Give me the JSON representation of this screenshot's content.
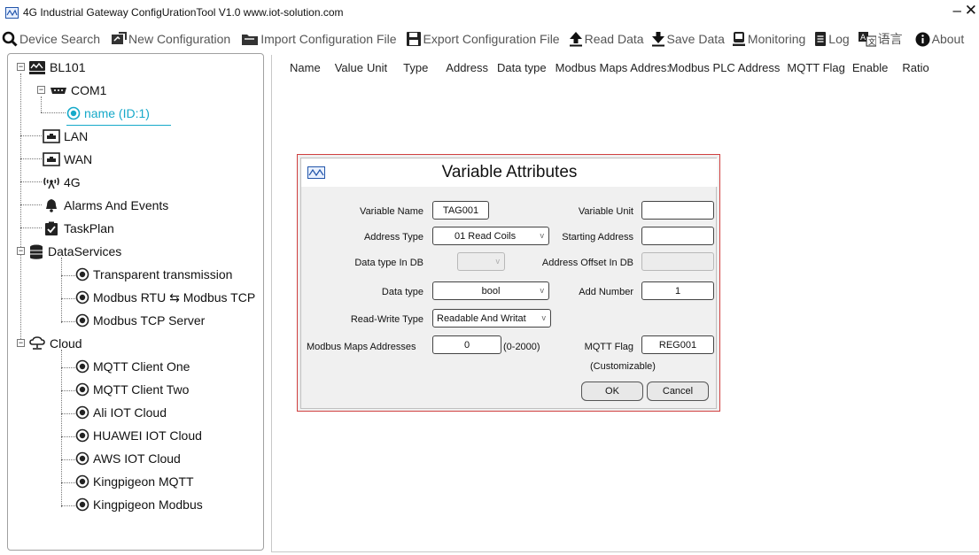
{
  "window": {
    "title": "4G Industrial Gateway ConfigUrationTool V1.0 www.iot-solution.com",
    "minimize_glyph": "–",
    "close_glyph": "✕"
  },
  "toolbar": {
    "device_search": "Device Search",
    "new_configuration": "New Configuration",
    "import_configuration": "Import Configuration File",
    "export_configuration": "Export Configuration File",
    "read_data": "Read Data",
    "save_data": "Save Data",
    "monitoring": "Monitoring",
    "log": "Log",
    "language": "语言",
    "about": "About"
  },
  "tree": {
    "root": "BL101",
    "com1": "COM1",
    "com1_child": "name  (ID:1)",
    "lan": "LAN",
    "wan": "WAN",
    "net4g": "4G",
    "alarms": "Alarms And Events",
    "taskplan": "TaskPlan",
    "dataservices": "DataServices",
    "transparent": "Transparent transmission",
    "modbus_rtu_tcp": "Modbus RTU ⇆ Modbus TCP",
    "modbus_tcp_server": "Modbus TCP Server",
    "cloud": "Cloud",
    "mqtt_one": "MQTT Client One",
    "mqtt_two": "MQTT Client Two",
    "ali": "Ali IOT Cloud",
    "huawei": "HUAWEI IOT Cloud",
    "aws": "AWS IOT Cloud",
    "kp_mqtt": "Kingpigeon MQTT",
    "kp_modbus": "Kingpigeon Modbus",
    "expand_glyph": "−"
  },
  "grid": {
    "columns": [
      "Name",
      "Value",
      "Unit",
      "Type",
      "Address",
      "Data type",
      "Modbus Maps Addres:",
      "Modbus PLC Address",
      "MQTT Flag",
      "Enable",
      "Ratio"
    ]
  },
  "dialog": {
    "title": "Variable Attributes",
    "variable_name_label": "Variable Name",
    "variable_name_value": "TAG001",
    "variable_unit_label": "Variable Unit",
    "variable_unit_value": "",
    "address_type_label": "Address Type",
    "address_type_value": "01 Read Coils",
    "starting_address_label": "Starting Address",
    "starting_address_value": "",
    "data_type_in_db_label": "Data type In DB",
    "data_type_in_db_value": "",
    "address_offset_label": "Address Offset In DB",
    "address_offset_value": "",
    "data_type_label": "Data type",
    "data_type_value": "bool",
    "add_number_label": "Add Number",
    "add_number_value": "1",
    "rw_type_label": "Read-Write Type",
    "rw_type_value": "Readable And Writat",
    "modbus_maps_label": "Modbus Maps Addresses",
    "modbus_maps_value": "0",
    "modbus_maps_range": "(0-2000)",
    "mqtt_flag_label": "MQTT Flag",
    "mqtt_flag_value": "REG001",
    "customizable_note": "(Customizable)",
    "ok_label": "OK",
    "cancel_label": "Cancel",
    "chevron_glyph": "v"
  },
  "colors": {
    "selection": "#16a9c9",
    "dialog_border": "#d04040",
    "dialog_bg": "#f0f0f0"
  },
  "icons": {
    "app": "gateway-app-icon",
    "device_search": "magnifier-icon",
    "new_configuration": "new-config-icon",
    "import": "folder-import-icon",
    "export": "floppy-disk-icon",
    "read_data": "arrow-up-icon",
    "save_data": "arrow-down-icon",
    "monitoring": "monitor-icon",
    "log": "log-icon",
    "language": "translate-icon",
    "about": "info-icon"
  }
}
